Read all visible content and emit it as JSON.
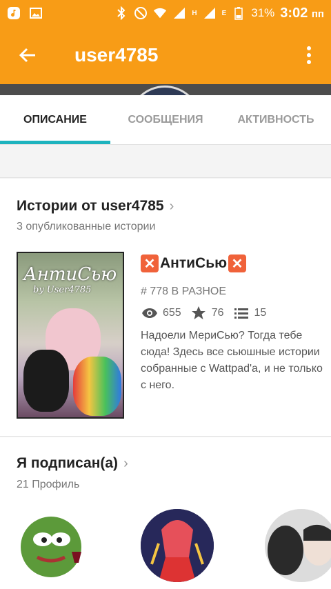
{
  "status_bar": {
    "network_h": "H",
    "network_e": "E",
    "battery": "31%",
    "time": "3:02",
    "ampm": "пп"
  },
  "app_bar": {
    "title": "user4785"
  },
  "tabs": [
    {
      "label": "ОПИСАНИЕ",
      "active": true
    },
    {
      "label": "СООБЩЕНИЯ",
      "active": false
    },
    {
      "label": "АКТИВНОСТЬ",
      "active": false
    }
  ],
  "stories": {
    "title": "Истории от user4785",
    "subtitle": "3 опубликованные истории",
    "cover_title": "АнтиСью",
    "cover_sub": "by User4785",
    "story": {
      "title": "АнтиСью",
      "rank": "# 778 В РАЗНОЕ",
      "reads": "655",
      "votes": "76",
      "parts": "15",
      "description": "Надоели МериСью? Тогда тебе сюда! Здесь все сьюшные истории собранные с Wattpad'а, и не только с него."
    }
  },
  "following": {
    "title": "Я подписан(а)",
    "subtitle": "21 Профиль"
  },
  "colors": {
    "accent": "#f89c16",
    "tab_indicator": "#1eb3be"
  }
}
